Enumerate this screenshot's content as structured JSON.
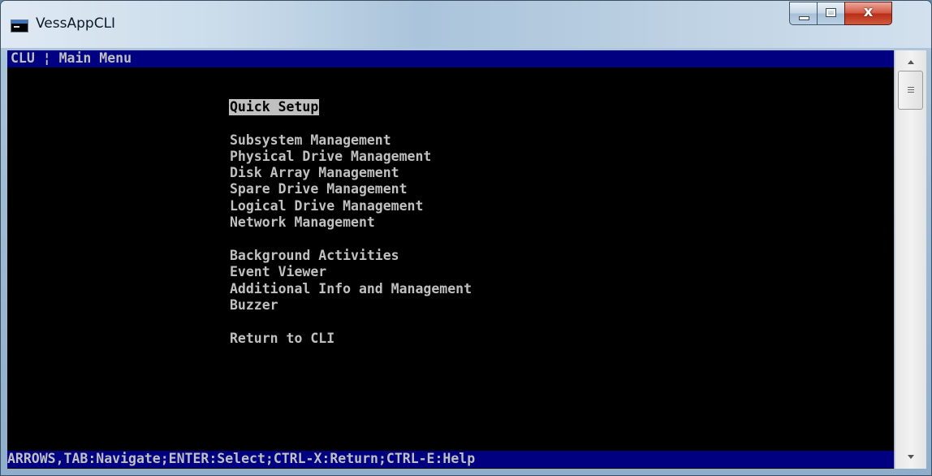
{
  "window": {
    "title": "VessAppCLI",
    "close_glyph": "x"
  },
  "terminal": {
    "header": "CLU ¦ Main Menu",
    "menu": [
      {
        "label": "Quick Setup",
        "selected": true
      },
      {
        "label": "Subsystem Management",
        "selected": false
      },
      {
        "label": "Physical Drive Management",
        "selected": false
      },
      {
        "label": "Disk Array Management",
        "selected": false
      },
      {
        "label": "Spare Drive Management",
        "selected": false
      },
      {
        "label": "Logical Drive Management",
        "selected": false
      },
      {
        "label": "Network Management",
        "selected": false
      },
      {
        "label": "Background Activities",
        "selected": false
      },
      {
        "label": "Event Viewer",
        "selected": false
      },
      {
        "label": "Additional Info and Management",
        "selected": false
      },
      {
        "label": "Buzzer",
        "selected": false
      },
      {
        "label": "Return to CLI",
        "selected": false
      }
    ],
    "footer": "ARROWS,TAB:Navigate;ENTER:Select;CTRL-X:Return;CTRL-E:Help"
  },
  "colors": {
    "console_bg": "#000000",
    "bar_bg": "#000080",
    "text": "#c0c0c0",
    "selected_bg": "#c0c0c0"
  },
  "icons": [
    "console-app-icon",
    "minimize-icon",
    "maximize-icon",
    "close-icon",
    "scroll-up-icon",
    "scroll-down-icon"
  ]
}
